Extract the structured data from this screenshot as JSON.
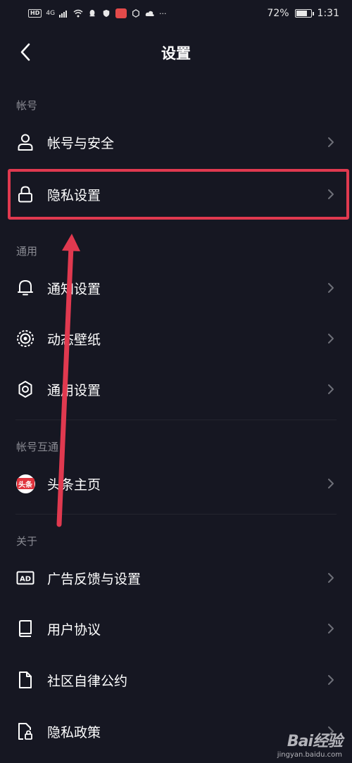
{
  "status_bar": {
    "hd": "HD",
    "signal": "4G",
    "more": "···",
    "battery_percent": "72%",
    "battery_level": 0.72,
    "time": "1:31"
  },
  "header": {
    "title": "设置",
    "back_icon": "chevron-left-icon"
  },
  "sections": [
    {
      "title": "帐号",
      "items": [
        {
          "label": "帐号与安全",
          "icon": "user-icon"
        },
        {
          "label": "隐私设置",
          "icon": "lock-icon",
          "highlighted": true
        }
      ]
    },
    {
      "title": "通用",
      "items": [
        {
          "label": "通知设置",
          "icon": "bell-icon"
        },
        {
          "label": "动态壁纸",
          "icon": "live-wallpaper-icon"
        },
        {
          "label": "通用设置",
          "icon": "gear-icon"
        }
      ]
    },
    {
      "title": "帐号互通",
      "items": [
        {
          "label": "头条主页",
          "icon": "toutiao-icon",
          "badge_text": "头条"
        }
      ]
    },
    {
      "title": "关于",
      "items": [
        {
          "label": "广告反馈与设置",
          "icon": "ad-icon",
          "badge_text": "AD"
        },
        {
          "label": "用户协议",
          "icon": "book-icon"
        },
        {
          "label": "社区自律公约",
          "icon": "document-icon"
        },
        {
          "label": "隐私政策",
          "icon": "privacy-document-icon"
        }
      ]
    }
  ],
  "annotation": {
    "highlight_color": "#e0394f"
  },
  "watermark": {
    "logo": "Bai经验",
    "url": "jingyan.baidu.com"
  },
  "colors": {
    "background": "#161722",
    "text_primary": "#ffffff",
    "text_secondary": "#8a8b93",
    "chevron": "#6e6f78"
  }
}
